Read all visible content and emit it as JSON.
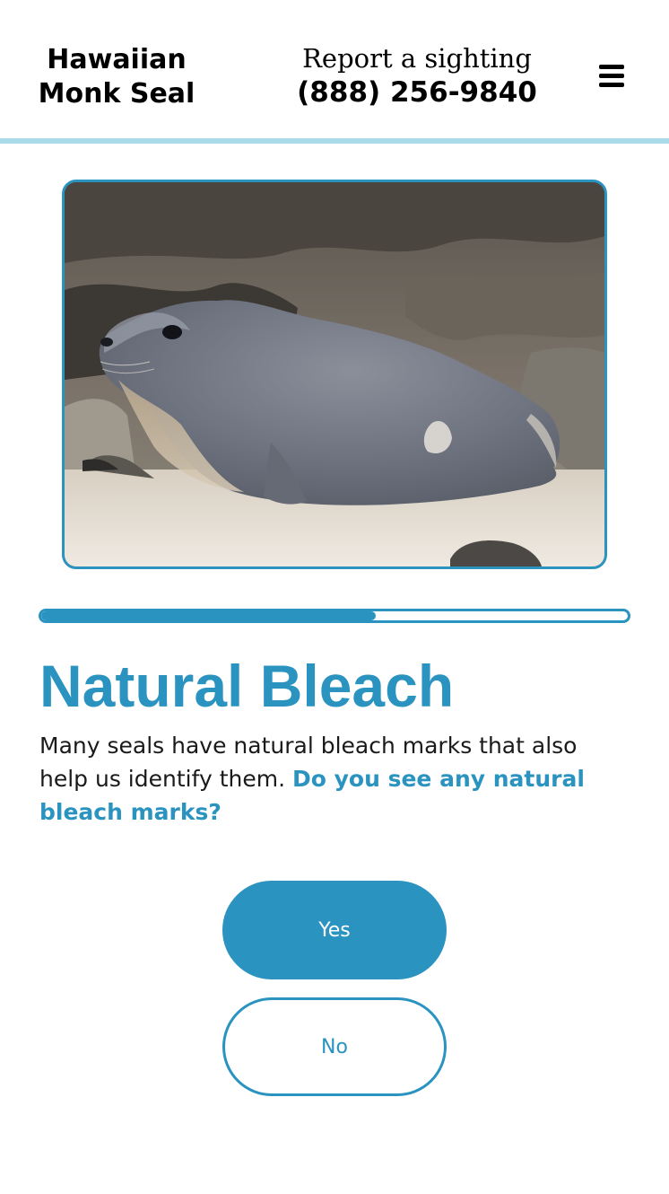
{
  "header": {
    "brand_line1": "Hawaiian",
    "brand_line2": "Monk Seal",
    "report_label": "Report a sighting",
    "report_phone": "(888) 256-9840",
    "menu_icon": "hamburger-menu-icon"
  },
  "photo": {
    "subject": "seal-photo"
  },
  "progress": {
    "fraction": 0.57
  },
  "step": {
    "title": "Natural Bleach",
    "description": " Many seals have natural bleach marks that also help us identify them. ",
    "question": "Do you see any natural bleach marks?"
  },
  "actions": {
    "yes_label": "Yes",
    "no_label": "No"
  },
  "colors": {
    "accent": "#2a93c0",
    "header_rule": "#a9dbe8"
  }
}
